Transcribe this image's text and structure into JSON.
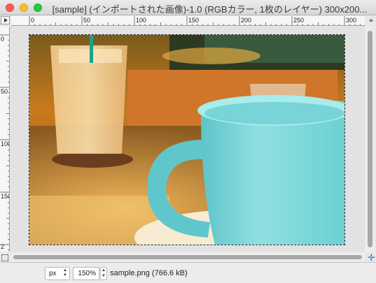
{
  "window": {
    "title": "[sample] (インポートされた画像)-1.0 (RGBカラー, 1枚のレイヤー) 300x200..."
  },
  "rulers": {
    "horizontal_labels": [
      "0",
      "50",
      "100",
      "150",
      "200",
      "250",
      "300"
    ],
    "vertical_labels": [
      "0",
      "50",
      "100",
      "150",
      "2"
    ],
    "unit": "px"
  },
  "canvas": {
    "image_name": "sample.png",
    "description_icon": "coffee-photo"
  },
  "status": {
    "unit": "px",
    "zoom": "150%",
    "file_info": "sample.png (766.6 kB)"
  },
  "icons": {
    "menu": "menu-triangle-icon",
    "navigate": "navigate-icon",
    "quick_mask": "quick-mask-icon",
    "move": "move-arrows-icon"
  },
  "colors": {
    "close": "#fc5f57",
    "minimize": "#fdbc2e",
    "zoom": "#28c840",
    "move_icon": "#2a6fd3"
  }
}
